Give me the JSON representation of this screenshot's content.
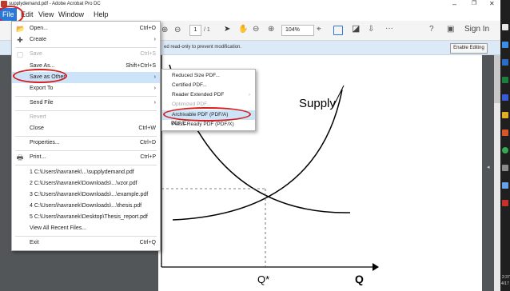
{
  "window": {
    "title": "supplydemand.pdf - Adobe Acrobat Pro DC",
    "minimize": "–",
    "restore": "❐",
    "close": "✕"
  },
  "menubar": [
    "File",
    "Edit",
    "View",
    "Window",
    "Help"
  ],
  "toolbar": {
    "page_current": "1",
    "page_total": "/ 1",
    "zoom": "104%",
    "more": "···",
    "sign_in": "Sign In"
  },
  "notice": {
    "text": "ed read-only to prevent modification.",
    "button": "Enable Editing"
  },
  "file_menu": {
    "items": [
      {
        "label": "Open...",
        "shortcut": "Ctrl+O",
        "icon": "open-folder-icon",
        "disabled": false
      },
      {
        "label": "Create",
        "shortcut": "›",
        "icon": "create-icon",
        "disabled": false
      },
      {
        "label": "Save",
        "shortcut": "Ctrl+S",
        "icon": "save-icon",
        "disabled": true
      },
      {
        "label": "Save As...",
        "shortcut": "Shift+Ctrl+S",
        "disabled": false
      },
      {
        "label": "Save as Other",
        "shortcut": "›",
        "disabled": false,
        "highlight": true
      },
      {
        "label": "Export To",
        "shortcut": "›",
        "disabled": false
      },
      {
        "label": "Send File",
        "shortcut": "›",
        "disabled": false
      },
      {
        "label": "Revert",
        "shortcut": "",
        "disabled": true
      },
      {
        "label": "Close",
        "shortcut": "Ctrl+W",
        "disabled": false
      },
      {
        "label": "Properties...",
        "shortcut": "Ctrl+D",
        "disabled": false
      },
      {
        "label": "Print...",
        "shortcut": "Ctrl+P",
        "icon": "print-icon",
        "disabled": false
      }
    ],
    "recent": [
      "1 C:\\Users\\havranek\\...\\supplydemand.pdf",
      "2 C:\\Users\\havranek\\Downloads\\...\\vzor.pdf",
      "3 C:\\Users\\havranek\\Downloads\\...\\example.pdf",
      "4 C:\\Users\\havranek\\Downloads\\...\\thesis.pdf",
      "5 C:\\Users\\havranek\\Desktop\\Thesis_report.pdf"
    ],
    "view_all_recent": "View All Recent Files...",
    "exit": {
      "label": "Exit",
      "shortcut": "Ctrl+Q"
    }
  },
  "submenu": {
    "items": [
      {
        "label": "Reduced Size PDF...",
        "disabled": false
      },
      {
        "label": "Certified PDF...",
        "disabled": false
      },
      {
        "label": "Reader Extended PDF",
        "disabled": false,
        "arrow": "›"
      },
      {
        "label": "Optimized PDF...",
        "disabled": true
      },
      {
        "label": "Archivable PDF (PDF/A)",
        "disabled": false,
        "highlight": true
      },
      {
        "label": "Press-Ready PDF (PDF/X)",
        "disabled": false
      },
      {
        "label": "PDF/E",
        "disabled": false
      }
    ]
  },
  "document": {
    "supply_label": "Supply",
    "q_star": "Q*",
    "q_label": "Q"
  },
  "taskbar": {
    "time": "2:37",
    "date": "4/17"
  },
  "colors": {
    "accent": "#2b78d8",
    "highlight": "#cde3f7",
    "annotation": "#d42020",
    "doc_bg": "#525659"
  }
}
